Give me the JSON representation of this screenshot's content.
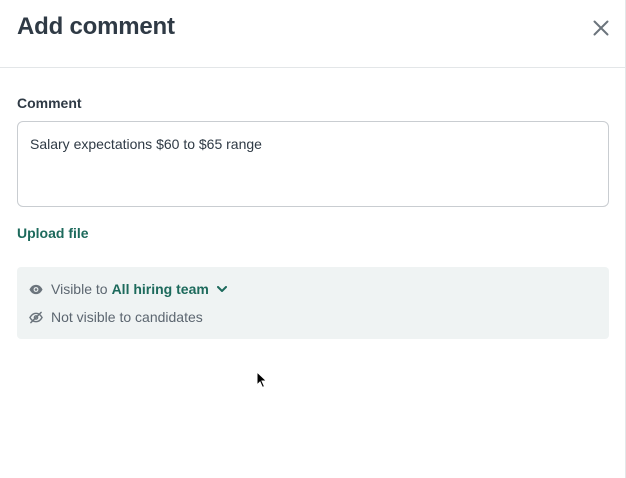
{
  "modal": {
    "title": "Add comment"
  },
  "comment": {
    "label": "Comment",
    "value": "Salary expectations $60 to $65 range"
  },
  "upload": {
    "label": "Upload file"
  },
  "visibility": {
    "prefix": "Visible to",
    "selected": "All hiring team",
    "note": "Not visible to candidates"
  },
  "colors": {
    "accent": "#1d6a5c",
    "panel_bg": "#eff3f3",
    "text": "#2f3a45",
    "muted": "#5c6670"
  },
  "icons": {
    "close": "close-icon",
    "eye": "eye-icon",
    "eye_off": "eye-off-icon",
    "chevron": "chevron-down-icon"
  }
}
